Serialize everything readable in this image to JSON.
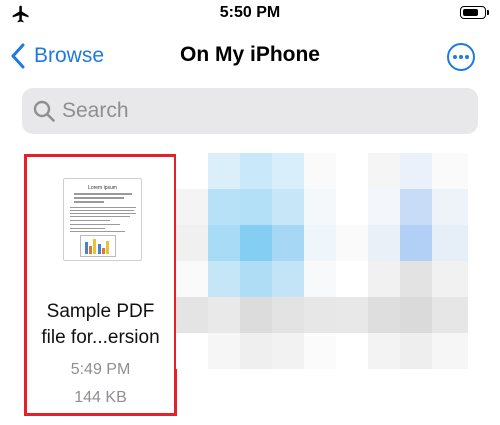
{
  "status_bar": {
    "time": "5:50 PM",
    "battery_level": 0.75
  },
  "nav": {
    "back_label": "Browse",
    "title": "On My iPhone"
  },
  "search": {
    "placeholder": "Search",
    "value": ""
  },
  "files": [
    {
      "name_line1": "Sample PDF",
      "name_line2": "file for...ersion",
      "time": "5:49 PM",
      "size": "144 KB",
      "selected": true,
      "thumbnail_title": "Lorem ipsum"
    }
  ],
  "colors": {
    "accent": "#1f7ae0",
    "selection_border": "#e5202a",
    "secondary_text": "#8e8e93",
    "search_bg": "#e8e8ea"
  }
}
